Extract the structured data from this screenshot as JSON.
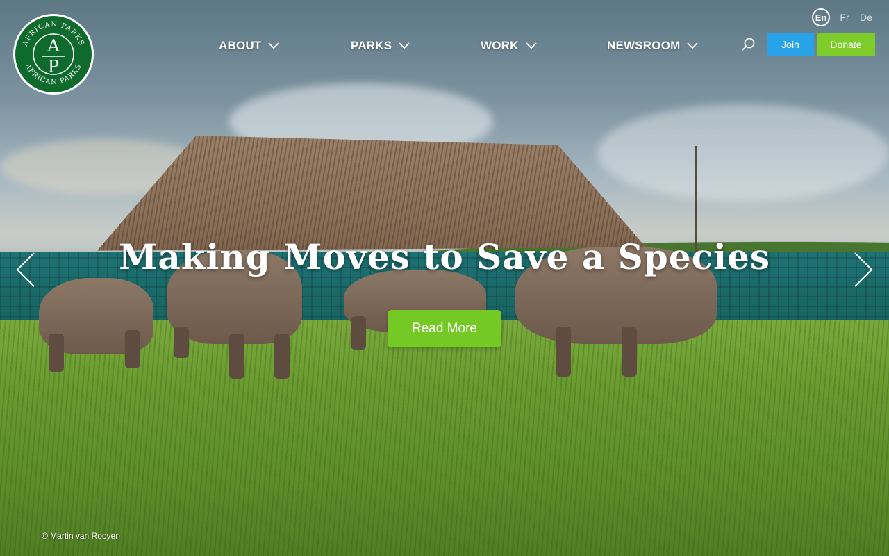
{
  "logo": {
    "ring_text_top": "AFRICAN PARKS",
    "ring_text_bottom": "AFRICAN PARKS",
    "letter_top": "A",
    "letter_bottom": "P",
    "color": "#0f6a2d"
  },
  "nav": {
    "items": [
      {
        "label": "ABOUT",
        "icon": "chevron-down-icon"
      },
      {
        "label": "PARKS",
        "icon": "chevron-down-icon"
      },
      {
        "label": "WORK",
        "icon": "chevron-down-icon"
      },
      {
        "label": "NEWSROOM",
        "icon": "chevron-down-icon"
      }
    ]
  },
  "languages": {
    "selected": "En",
    "options": [
      "En",
      "Fr",
      "De"
    ]
  },
  "header": {
    "search_icon": "search-icon",
    "join_label": "Join",
    "donate_label": "Donate",
    "join_color": "#29a3e8",
    "donate_color": "#7dcc2a"
  },
  "slide": {
    "headline": "Making Moves to Save a Species",
    "cta_label": "Read More",
    "cta_color": "#74c924",
    "prev_icon": "chevron-left-icon",
    "next_icon": "chevron-right-icon",
    "photo_credit": "© Martin van Rooyen"
  }
}
